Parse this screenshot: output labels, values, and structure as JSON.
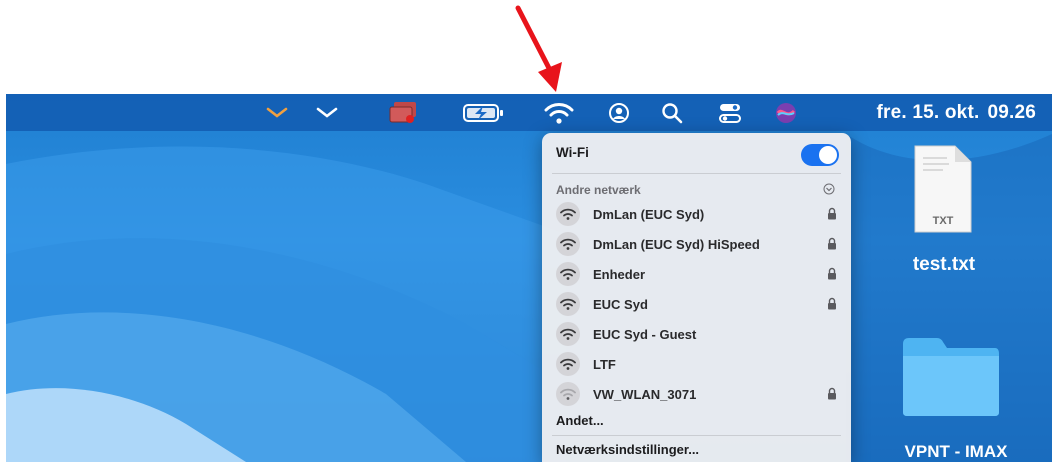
{
  "menubar": {
    "clock_day": "fre. 15. okt.",
    "clock_time": "09.26",
    "icons": [
      "chevron-icon",
      "chevron-icon",
      "screen-record-icon",
      "battery-charging-icon",
      "wifi-icon",
      "user-icon",
      "search-icon",
      "control-center-icon",
      "siri-icon"
    ]
  },
  "wifi_menu": {
    "title": "Wi-Fi",
    "toggle_on": true,
    "section_label": "Andre netværk",
    "networks": [
      {
        "name": "DmLan (EUC Syd)",
        "locked": true
      },
      {
        "name": "DmLan (EUC Syd) HiSpeed",
        "locked": true
      },
      {
        "name": "Enheder",
        "locked": true
      },
      {
        "name": "EUC Syd",
        "locked": true
      },
      {
        "name": "EUC Syd - Guest",
        "locked": false
      },
      {
        "name": "LTF",
        "locked": false
      },
      {
        "name": "VW_WLAN_3071",
        "locked": true
      }
    ],
    "other": "Andet...",
    "settings": "Netværksindstillinger..."
  },
  "desktop": {
    "file_badge": "TXT",
    "file_name": "test.txt",
    "folder_caption": "VPNT - IMAX"
  },
  "colors": {
    "accent": "#1a72f0",
    "annotation_arrow": "#e8141b",
    "menubar": "#125cb2"
  }
}
